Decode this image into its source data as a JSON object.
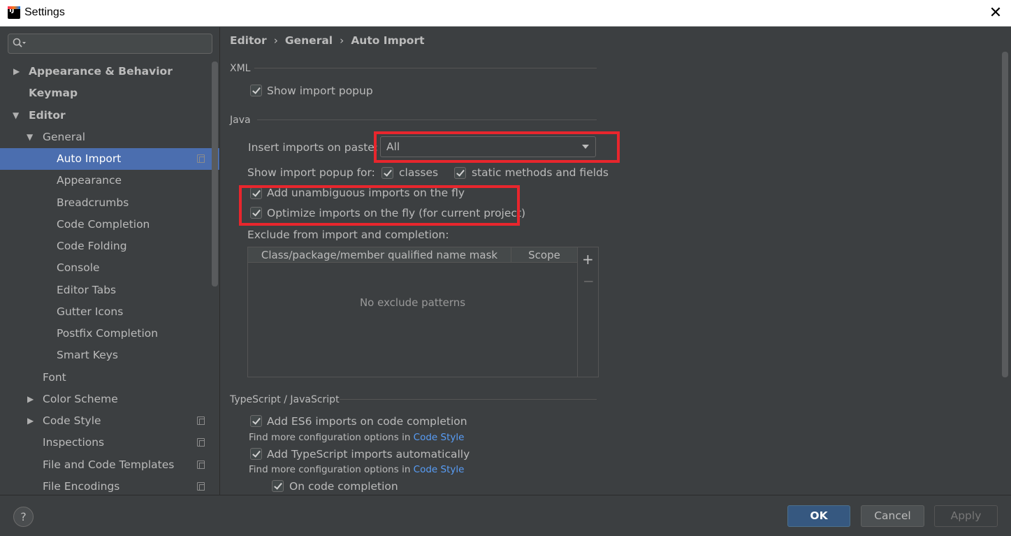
{
  "window": {
    "title": "Settings",
    "close_symbol": "✕"
  },
  "sidebar": {
    "search_placeholder": "",
    "items": [
      {
        "label": "Appearance & Behavior"
      },
      {
        "label": "Keymap"
      },
      {
        "label": "Editor"
      },
      {
        "label": "General"
      },
      {
        "label": "Auto Import"
      },
      {
        "label": "Appearance"
      },
      {
        "label": "Breadcrumbs"
      },
      {
        "label": "Code Completion"
      },
      {
        "label": "Code Folding"
      },
      {
        "label": "Console"
      },
      {
        "label": "Editor Tabs"
      },
      {
        "label": "Gutter Icons"
      },
      {
        "label": "Postfix Completion"
      },
      {
        "label": "Smart Keys"
      },
      {
        "label": "Font"
      },
      {
        "label": "Color Scheme"
      },
      {
        "label": "Code Style"
      },
      {
        "label": "Inspections"
      },
      {
        "label": "File and Code Templates"
      },
      {
        "label": "File Encodings"
      }
    ]
  },
  "breadcrumb": [
    "Editor",
    "General",
    "Auto Import"
  ],
  "xml": {
    "title": "XML",
    "show_import_popup": {
      "label": "Show import popup",
      "checked": true
    }
  },
  "java": {
    "title": "Java",
    "insert_imports_label": "Insert imports on paste:",
    "insert_imports_value": "All",
    "show_popup_for_label": "Show import popup for:",
    "classes": {
      "label": "classes",
      "checked": true
    },
    "static_methods": {
      "label": "static methods and fields",
      "checked": true
    },
    "add_unambiguous": {
      "label": "Add unambiguous imports on the fly",
      "checked": true
    },
    "optimize_imports": {
      "label": "Optimize imports on the fly (for current project)",
      "checked": true
    },
    "exclude_label": "Exclude from import and completion:",
    "table": {
      "columns": [
        "Class/package/member qualified name mask",
        "Scope"
      ],
      "empty_text": "No exclude patterns",
      "add_symbol": "+",
      "remove_symbol": "−"
    }
  },
  "typescript": {
    "title": "TypeScript / JavaScript",
    "es6": {
      "label": "Add ES6 imports on code completion",
      "checked": true
    },
    "find_more_1": "Find more configuration options in",
    "link_1": "Code Style",
    "ts_auto": {
      "label": "Add TypeScript imports automatically",
      "checked": true
    },
    "find_more_2": "Find more configuration options in",
    "link_2": "Code Style",
    "on_completion": {
      "label": "On code completion",
      "checked": true
    }
  },
  "footer": {
    "help_symbol": "?",
    "ok": "OK",
    "cancel": "Cancel",
    "apply": "Apply"
  },
  "colors": {
    "background": "#3c3f41",
    "selection": "#4b6eaf",
    "highlight_box": "#e8262d",
    "link": "#589df6",
    "ok_button": "#365880"
  }
}
